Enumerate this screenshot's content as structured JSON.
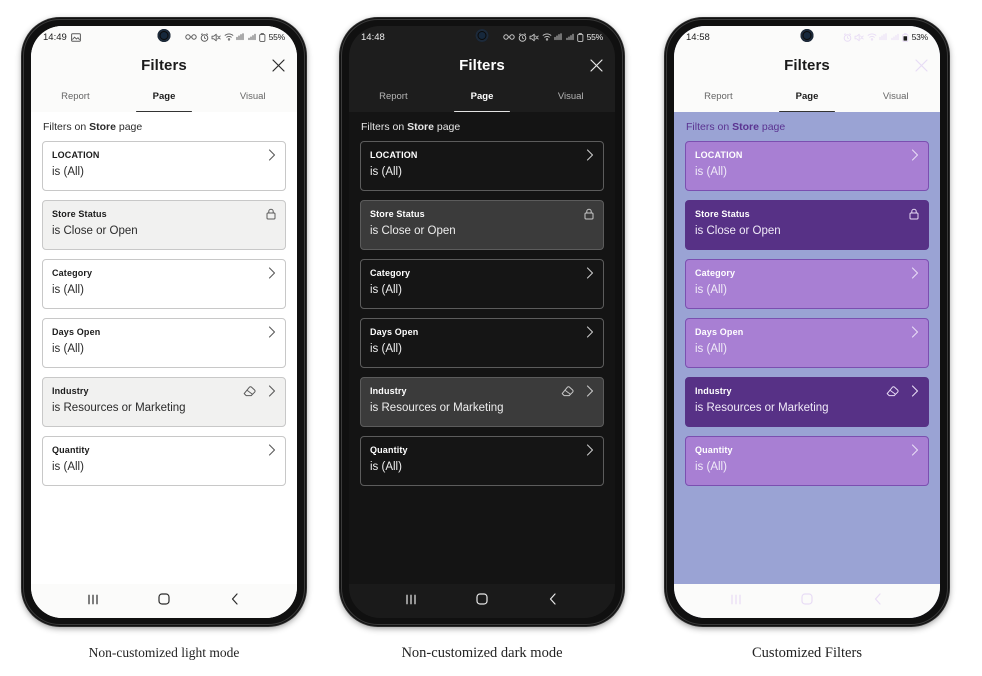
{
  "phones": [
    {
      "id": "light",
      "theme": "t-light",
      "caption": "Non-customized light mode",
      "status": {
        "clock": "14:49",
        "battery": "55%",
        "icons": [
          "image-icon",
          "vpn-icon",
          "alarm-icon",
          "mute-icon",
          "wifi-icon",
          "signal-hotspot-icon",
          "signal-bars-icon",
          "battery-lock-icon"
        ]
      },
      "header": {
        "title": "Filters",
        "close_label": "close-icon"
      },
      "tabs": [
        {
          "label": "Report",
          "active": false
        },
        {
          "label": "Page",
          "active": true
        },
        {
          "label": "Visual",
          "active": false
        }
      ],
      "body_head": {
        "prefix": "Filters on ",
        "page": "Store",
        "suffix": " page"
      },
      "cards": [
        {
          "name": "LOCATION",
          "value": "is (All)",
          "locked": false,
          "eraser": false,
          "chevron": true
        },
        {
          "name": "Store Status",
          "value": "is Close or Open",
          "locked": true,
          "eraser": false,
          "chevron": false
        },
        {
          "name": "Category",
          "value": "is (All)",
          "locked": false,
          "eraser": false,
          "chevron": true
        },
        {
          "name": "Days Open",
          "value": "is (All)",
          "locked": false,
          "eraser": false,
          "chevron": true
        },
        {
          "name": "Industry",
          "value": "is Resources or Marketing",
          "locked": true,
          "eraser": true,
          "chevron": true
        },
        {
          "name": "Quantity",
          "value": "is (All)",
          "locked": false,
          "eraser": false,
          "chevron": true
        }
      ],
      "nav": [
        "recents-icon",
        "home-icon",
        "back-icon"
      ]
    },
    {
      "id": "dark",
      "theme": "t-dark",
      "caption": "Non-customized dark mode",
      "status": {
        "clock": "14:48",
        "battery": "55%",
        "icons": [
          "vpn-icon",
          "alarm-icon",
          "mute-icon",
          "wifi-icon",
          "signal-hotspot-icon",
          "signal-bars-icon",
          "battery-lock-icon"
        ]
      },
      "header": {
        "title": "Filters",
        "close_label": "close-icon"
      },
      "tabs": [
        {
          "label": "Report",
          "active": false
        },
        {
          "label": "Page",
          "active": true
        },
        {
          "label": "Visual",
          "active": false
        }
      ],
      "body_head": {
        "prefix": "Filters on ",
        "page": "Store",
        "suffix": " page"
      },
      "cards": [
        {
          "name": "LOCATION",
          "value": "is (All)",
          "locked": false,
          "eraser": false,
          "chevron": true
        },
        {
          "name": "Store Status",
          "value": "is Close or Open",
          "locked": true,
          "eraser": false,
          "chevron": false
        },
        {
          "name": "Category",
          "value": "is (All)",
          "locked": false,
          "eraser": false,
          "chevron": true
        },
        {
          "name": "Days Open",
          "value": "is (All)",
          "locked": false,
          "eraser": false,
          "chevron": true
        },
        {
          "name": "Industry",
          "value": "is Resources or Marketing",
          "locked": true,
          "eraser": true,
          "chevron": true
        },
        {
          "name": "Quantity",
          "value": "is (All)",
          "locked": false,
          "eraser": false,
          "chevron": true
        }
      ],
      "nav": [
        "recents-icon",
        "home-icon",
        "back-icon"
      ]
    },
    {
      "id": "custom",
      "theme": "t-custom",
      "caption": "Customized Filters",
      "status": {
        "clock": "14:58",
        "battery": "53%",
        "icons": [
          "alarm-icon",
          "mute-icon",
          "wifi-icon",
          "signal-hotspot-icon",
          "signal-bars-icon",
          "battery-icon"
        ]
      },
      "header": {
        "title": "Filters",
        "close_label": "close-icon"
      },
      "tabs": [
        {
          "label": "Report",
          "active": false
        },
        {
          "label": "Page",
          "active": true
        },
        {
          "label": "Visual",
          "active": false
        }
      ],
      "body_head": {
        "prefix": "Filters on ",
        "page": "Store",
        "suffix": " page"
      },
      "cards": [
        {
          "name": "LOCATION",
          "value": "is (All)",
          "locked": false,
          "eraser": false,
          "chevron": true
        },
        {
          "name": "Store Status",
          "value": "is Close or Open",
          "locked": true,
          "eraser": false,
          "chevron": false
        },
        {
          "name": "Category",
          "value": "is (All)",
          "locked": false,
          "eraser": false,
          "chevron": true
        },
        {
          "name": "Days Open",
          "value": "is (All)",
          "locked": false,
          "eraser": false,
          "chevron": true
        },
        {
          "name": "Industry",
          "value": "is Resources or Marketing",
          "locked": true,
          "eraser": true,
          "chevron": true
        },
        {
          "name": "Quantity",
          "value": "is (All)",
          "locked": false,
          "eraser": false,
          "chevron": true
        }
      ],
      "nav": [
        "recents-icon",
        "home-icon",
        "back-icon"
      ]
    }
  ],
  "colors": {
    "light_bg": "#ffffff",
    "light_card_locked": "#f1f1f0",
    "light_border": "#c8c8c8",
    "dark_bg": "#141414",
    "dark_card_locked": "#3b3b3b",
    "dark_border": "#5c5c5c",
    "custom_page_bg": "#9aa3d4",
    "custom_card": "#a87fd3",
    "custom_card_locked": "#573186",
    "custom_accent_text": "#5b3391"
  }
}
